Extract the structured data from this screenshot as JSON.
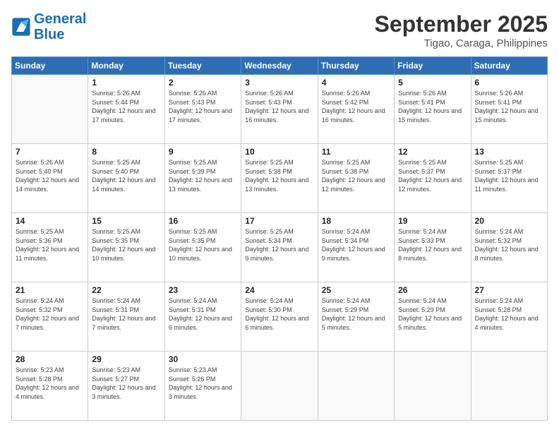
{
  "header": {
    "logo_line1": "General",
    "logo_line2": "Blue",
    "month": "September 2025",
    "location": "Tigao, Caraga, Philippines"
  },
  "weekdays": [
    "Sunday",
    "Monday",
    "Tuesday",
    "Wednesday",
    "Thursday",
    "Friday",
    "Saturday"
  ],
  "weeks": [
    [
      {
        "day": "",
        "sunrise": "",
        "sunset": "",
        "daylight": ""
      },
      {
        "day": "1",
        "sunrise": "Sunrise: 5:26 AM",
        "sunset": "Sunset: 5:44 PM",
        "daylight": "Daylight: 12 hours and 17 minutes."
      },
      {
        "day": "2",
        "sunrise": "Sunrise: 5:26 AM",
        "sunset": "Sunset: 5:43 PM",
        "daylight": "Daylight: 12 hours and 17 minutes."
      },
      {
        "day": "3",
        "sunrise": "Sunrise: 5:26 AM",
        "sunset": "Sunset: 5:43 PM",
        "daylight": "Daylight: 12 hours and 16 minutes."
      },
      {
        "day": "4",
        "sunrise": "Sunrise: 5:26 AM",
        "sunset": "Sunset: 5:42 PM",
        "daylight": "Daylight: 12 hours and 16 minutes."
      },
      {
        "day": "5",
        "sunrise": "Sunrise: 5:26 AM",
        "sunset": "Sunset: 5:41 PM",
        "daylight": "Daylight: 12 hours and 15 minutes."
      },
      {
        "day": "6",
        "sunrise": "Sunrise: 5:26 AM",
        "sunset": "Sunset: 5:41 PM",
        "daylight": "Daylight: 12 hours and 15 minutes."
      }
    ],
    [
      {
        "day": "7",
        "sunrise": "Sunrise: 5:26 AM",
        "sunset": "Sunset: 5:40 PM",
        "daylight": "Daylight: 12 hours and 14 minutes."
      },
      {
        "day": "8",
        "sunrise": "Sunrise: 5:25 AM",
        "sunset": "Sunset: 5:40 PM",
        "daylight": "Daylight: 12 hours and 14 minutes."
      },
      {
        "day": "9",
        "sunrise": "Sunrise: 5:25 AM",
        "sunset": "Sunset: 5:39 PM",
        "daylight": "Daylight: 12 hours and 13 minutes."
      },
      {
        "day": "10",
        "sunrise": "Sunrise: 5:25 AM",
        "sunset": "Sunset: 5:38 PM",
        "daylight": "Daylight: 12 hours and 13 minutes."
      },
      {
        "day": "11",
        "sunrise": "Sunrise: 5:25 AM",
        "sunset": "Sunset: 5:38 PM",
        "daylight": "Daylight: 12 hours and 12 minutes."
      },
      {
        "day": "12",
        "sunrise": "Sunrise: 5:25 AM",
        "sunset": "Sunset: 5:37 PM",
        "daylight": "Daylight: 12 hours and 12 minutes."
      },
      {
        "day": "13",
        "sunrise": "Sunrise: 5:25 AM",
        "sunset": "Sunset: 5:37 PM",
        "daylight": "Daylight: 12 hours and 11 minutes."
      }
    ],
    [
      {
        "day": "14",
        "sunrise": "Sunrise: 5:25 AM",
        "sunset": "Sunset: 5:36 PM",
        "daylight": "Daylight: 12 hours and 11 minutes."
      },
      {
        "day": "15",
        "sunrise": "Sunrise: 5:25 AM",
        "sunset": "Sunset: 5:35 PM",
        "daylight": "Daylight: 12 hours and 10 minutes."
      },
      {
        "day": "16",
        "sunrise": "Sunrise: 5:25 AM",
        "sunset": "Sunset: 5:35 PM",
        "daylight": "Daylight: 12 hours and 10 minutes."
      },
      {
        "day": "17",
        "sunrise": "Sunrise: 5:25 AM",
        "sunset": "Sunset: 5:34 PM",
        "daylight": "Daylight: 12 hours and 9 minutes."
      },
      {
        "day": "18",
        "sunrise": "Sunrise: 5:24 AM",
        "sunset": "Sunset: 5:34 PM",
        "daylight": "Daylight: 12 hours and 9 minutes."
      },
      {
        "day": "19",
        "sunrise": "Sunrise: 5:24 AM",
        "sunset": "Sunset: 5:33 PM",
        "daylight": "Daylight: 12 hours and 8 minutes."
      },
      {
        "day": "20",
        "sunrise": "Sunrise: 5:24 AM",
        "sunset": "Sunset: 5:32 PM",
        "daylight": "Daylight: 12 hours and 8 minutes."
      }
    ],
    [
      {
        "day": "21",
        "sunrise": "Sunrise: 5:24 AM",
        "sunset": "Sunset: 5:32 PM",
        "daylight": "Daylight: 12 hours and 7 minutes."
      },
      {
        "day": "22",
        "sunrise": "Sunrise: 5:24 AM",
        "sunset": "Sunset: 5:31 PM",
        "daylight": "Daylight: 12 hours and 7 minutes."
      },
      {
        "day": "23",
        "sunrise": "Sunrise: 5:24 AM",
        "sunset": "Sunset: 5:31 PM",
        "daylight": "Daylight: 12 hours and 6 minutes."
      },
      {
        "day": "24",
        "sunrise": "Sunrise: 5:24 AM",
        "sunset": "Sunset: 5:30 PM",
        "daylight": "Daylight: 12 hours and 6 minutes."
      },
      {
        "day": "25",
        "sunrise": "Sunrise: 5:24 AM",
        "sunset": "Sunset: 5:29 PM",
        "daylight": "Daylight: 12 hours and 5 minutes."
      },
      {
        "day": "26",
        "sunrise": "Sunrise: 5:24 AM",
        "sunset": "Sunset: 5:29 PM",
        "daylight": "Daylight: 12 hours and 5 minutes."
      },
      {
        "day": "27",
        "sunrise": "Sunrise: 5:24 AM",
        "sunset": "Sunset: 5:28 PM",
        "daylight": "Daylight: 12 hours and 4 minutes."
      }
    ],
    [
      {
        "day": "28",
        "sunrise": "Sunrise: 5:23 AM",
        "sunset": "Sunset: 5:28 PM",
        "daylight": "Daylight: 12 hours and 4 minutes."
      },
      {
        "day": "29",
        "sunrise": "Sunrise: 5:23 AM",
        "sunset": "Sunset: 5:27 PM",
        "daylight": "Daylight: 12 hours and 3 minutes."
      },
      {
        "day": "30",
        "sunrise": "Sunrise: 5:23 AM",
        "sunset": "Sunset: 5:26 PM",
        "daylight": "Daylight: 12 hours and 3 minutes."
      },
      {
        "day": "",
        "sunrise": "",
        "sunset": "",
        "daylight": ""
      },
      {
        "day": "",
        "sunrise": "",
        "sunset": "",
        "daylight": ""
      },
      {
        "day": "",
        "sunrise": "",
        "sunset": "",
        "daylight": ""
      },
      {
        "day": "",
        "sunrise": "",
        "sunset": "",
        "daylight": ""
      }
    ]
  ]
}
